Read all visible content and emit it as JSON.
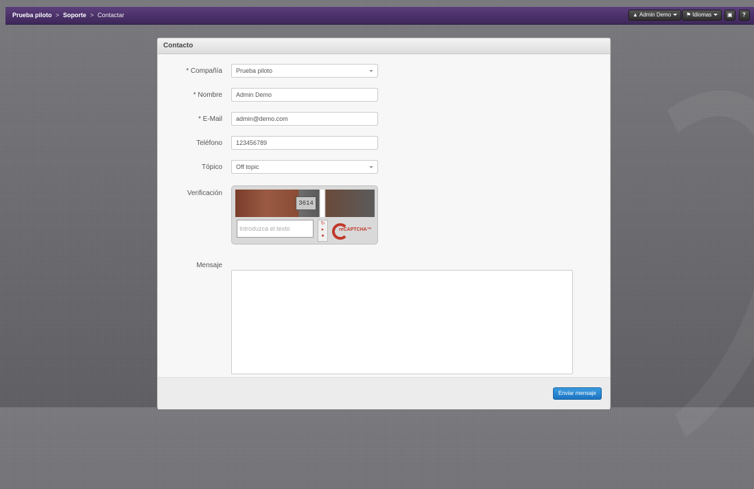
{
  "breadcrumb": {
    "item1": "Prueba piloto",
    "item2": "Soporte",
    "item3": "Contactar",
    "separator": ">"
  },
  "topbar": {
    "user_label": "Admin Demo",
    "languages_label": "Idiomas",
    "help_label": "?"
  },
  "form": {
    "title": "Contacto",
    "company": {
      "label": "* Compañía",
      "value": "Prueba piloto"
    },
    "name": {
      "label": "* Nombre",
      "value": "Admin Demo"
    },
    "email": {
      "label": "* E-Mail",
      "value": "admin@demo.com"
    },
    "phone": {
      "label": "Teléfono",
      "value": "123456789"
    },
    "topic": {
      "label": "Tópico",
      "value": "Off topic"
    },
    "verification": {
      "label": "Verificación",
      "captcha_number": "3614",
      "placeholder": "Introduzca el texto",
      "logo_text": "reCAPTCHA™"
    },
    "message": {
      "label": "Mensaje",
      "value": ""
    },
    "submit_label": "Enviar mensaje"
  }
}
